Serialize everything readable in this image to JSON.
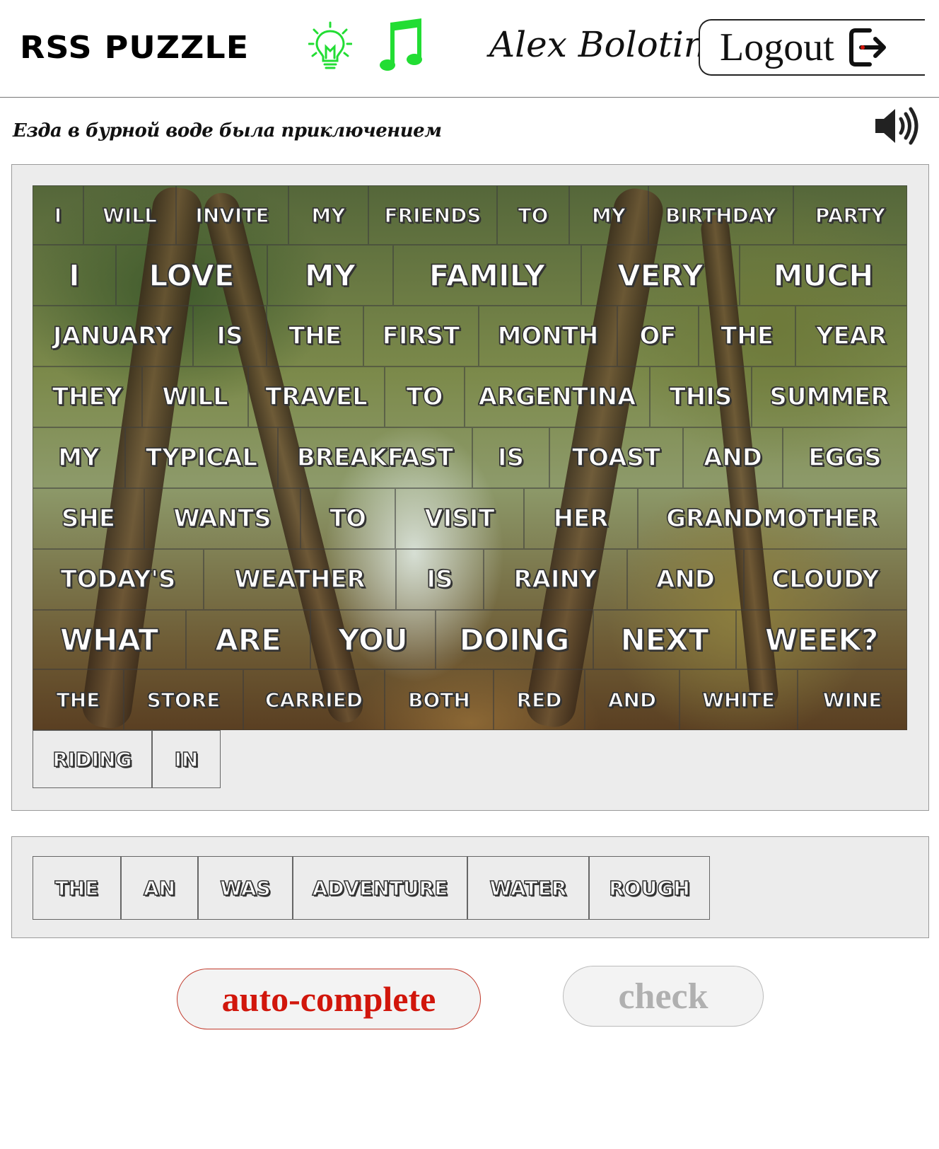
{
  "header": {
    "logo": "RSS PUZZLE",
    "user_name": "Alex Bolotin",
    "logout_label": "Logout",
    "hint_icon": "lightbulb-icon",
    "music_icon": "music-note-icon",
    "logout_icon": "logout-icon",
    "hint_color": "#22dd33",
    "music_color": "#22dd33"
  },
  "translation": {
    "text": "Езда в бурной воде была приключением",
    "sound_icon": "speaker-icon"
  },
  "board": {
    "completed_rows": [
      [
        "I",
        "will",
        "invite",
        "my",
        "friends",
        "to",
        "my",
        "birthday",
        "party"
      ],
      [
        "I",
        "love",
        "my",
        "family",
        "very",
        "much"
      ],
      [
        "January",
        "is",
        "the",
        "first",
        "month",
        "of",
        "the",
        "year"
      ],
      [
        "They",
        "will",
        "travel",
        "to",
        "Argentina",
        "this",
        "summer"
      ],
      [
        "My",
        "typical",
        "breakfast",
        "is",
        "toast",
        "and",
        "eggs"
      ],
      [
        "She",
        "wants",
        "to",
        "visit",
        "her",
        "grandmother"
      ],
      [
        "Today's",
        "weather",
        "is",
        "rainy",
        "and",
        "cloudy"
      ],
      [
        "What",
        "are",
        "you",
        "doing",
        "next",
        "week?"
      ],
      [
        "The",
        "store",
        "carried",
        "both",
        "red",
        "and",
        "white",
        "wine"
      ]
    ],
    "current_row": [
      "Riding",
      "in"
    ]
  },
  "source": {
    "pieces": [
      "the",
      "an",
      "was",
      "adventure",
      "water",
      "rough"
    ]
  },
  "buttons": {
    "auto_complete": "auto-complete",
    "check": "check"
  },
  "colors": {
    "accent_red": "#d1160b",
    "disabled_gray": "#b0b0b0",
    "panel_bg": "#ececec"
  }
}
